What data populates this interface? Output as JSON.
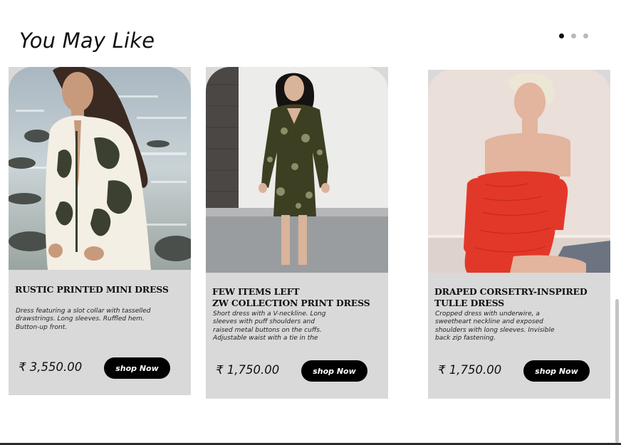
{
  "section": {
    "title": "You May Like"
  },
  "carousel": {
    "pages": 3,
    "active_index": 0
  },
  "products": [
    {
      "name_lines": [
        "Rustic Printed Mini Dress"
      ],
      "description": "Dress featuring a slot collar with tasselled drawstrings. Long sleeves. Ruffled hem. Button-up front.",
      "price": "₹ 3,550.00",
      "button": "shop Now"
    },
    {
      "name_lines": [
        "Few items left",
        "ZW Collection Print Dress"
      ],
      "description": "Short dress with a V-neckline. Long sleeves with puff shoulders and raised metal buttons on the cuffs. Adjustable waist with a tie in the",
      "price": "₹ 1,750.00",
      "button": "shop Now"
    },
    {
      "name_lines": [
        "Draped Corsetry-Inspired",
        "Tulle Dress"
      ],
      "description": "Cropped dress with underwire, a sweetheart neckline and exposed shoulders with long sleeves. Invisible back zip fastening.",
      "price": "₹ 1,750.00",
      "button": "shop Now"
    }
  ],
  "colors": {
    "card_bg": "#d9d9d9",
    "button_bg": "#000000",
    "button_text": "#ffffff",
    "dot_active": "#111111",
    "dot_inactive": "#b9b9b9"
  }
}
